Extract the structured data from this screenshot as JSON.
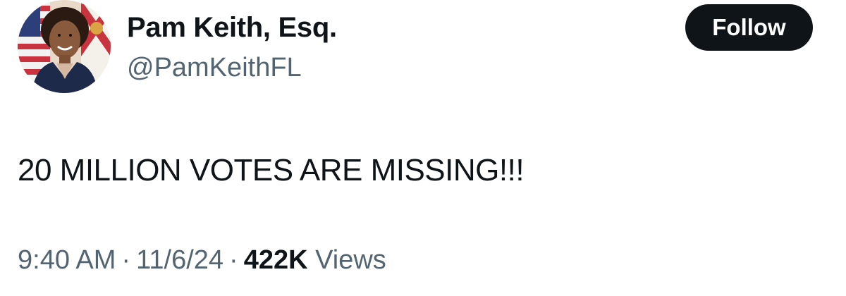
{
  "author": {
    "display_name": "Pam Keith, Esq.",
    "handle": "@PamKeithFL"
  },
  "follow_button": {
    "label": "Follow"
  },
  "tweet": {
    "text": "20 MILLION VOTES ARE MISSING!!!"
  },
  "meta": {
    "time": "9:40 AM",
    "separator": "·",
    "date": "11/6/24",
    "views_count": "422K",
    "views_label": "Views"
  },
  "colors": {
    "text_primary": "#0f1419",
    "text_secondary": "#536471",
    "follow_bg": "#0f1419",
    "follow_text": "#ffffff"
  }
}
